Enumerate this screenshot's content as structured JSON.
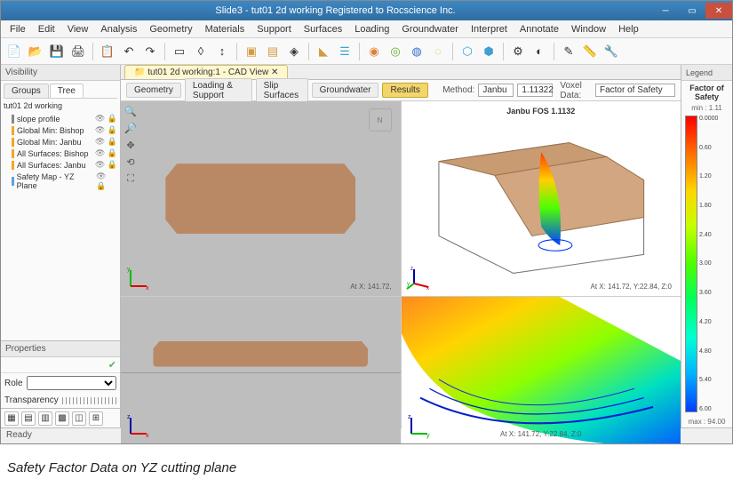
{
  "window": {
    "title": "Slide3 - tut01 2d working    Registered to Rocscience Inc."
  },
  "menu": [
    "File",
    "Edit",
    "View",
    "Analysis",
    "Geometry",
    "Materials",
    "Support",
    "Surfaces",
    "Loading",
    "Groundwater",
    "Interpret",
    "Annotate",
    "Window",
    "Help"
  ],
  "visibility": {
    "title": "Visibility",
    "tabs": [
      "Groups",
      "Tree"
    ],
    "project": "tut01 2d working",
    "items": [
      {
        "icon": "▸",
        "label": "slope profile",
        "color": "#888"
      },
      {
        "icon": "",
        "label": "Global Min: Bishop",
        "color": "#f5a623"
      },
      {
        "icon": "",
        "label": "Global Min: Janbu",
        "color": "#f5a623"
      },
      {
        "icon": "",
        "label": "All Surfaces: Bishop",
        "color": "#f5a623"
      },
      {
        "icon": "",
        "label": "All Surfaces: Janbu",
        "color": "#f5a623"
      },
      {
        "icon": "",
        "label": "Safety Map - YZ Plane",
        "color": "#5aa3e0"
      }
    ]
  },
  "properties": {
    "title": "Properties",
    "role_label": "Role",
    "trans_label": "Transparency"
  },
  "doc_tab": "tut01 2d working:1 - CAD View",
  "workflow": {
    "steps": [
      "Geometry",
      "Loading & Support",
      "Slip Surfaces",
      "Groundwater",
      "Results"
    ],
    "active": 4,
    "method_label": "Method:",
    "method": "Janbu",
    "method_val": "1.11322",
    "voxel_label": "Voxel Data:",
    "voxel": "Factor of Safety"
  },
  "viewport": {
    "tl_label": "Janbu FOS 1.1132",
    "coords1": "At X: 141.72,",
    "coords2": "At X: 141.72, Y:22.84, Z:0",
    "coords4": "At X: 141.72, Y:22.84, Z:0"
  },
  "legend": {
    "panel": "Legend",
    "title": "Factor of Safety",
    "min": "min : 1.11",
    "ticks": [
      "0.0000",
      "0.60",
      "1.20",
      "1.80",
      "2.40",
      "3.00",
      "3.60",
      "4.20",
      "4.80",
      "5.40",
      "6.00"
    ],
    "max": "max : 94.00"
  },
  "status": "Ready",
  "caption": "Safety Factor Data on YZ cutting plane"
}
